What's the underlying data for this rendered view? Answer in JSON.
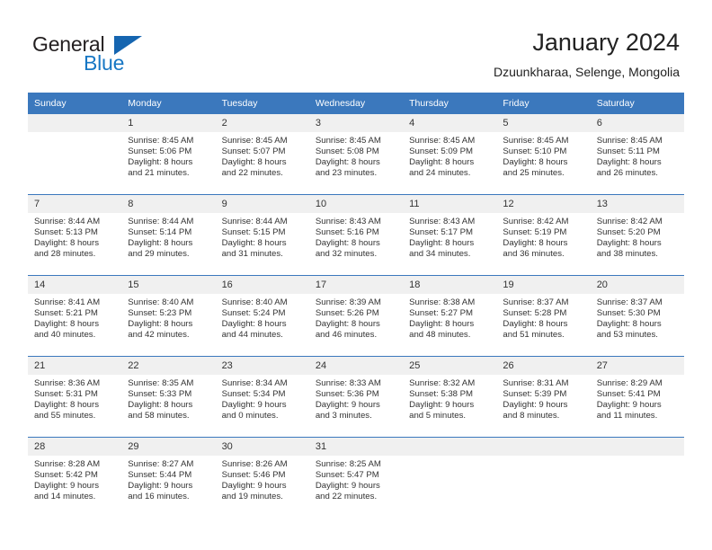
{
  "brand": {
    "name_top": "General",
    "name_bottom": "Blue",
    "triangle_color": "#1565b0",
    "blue_color": "#1777c4"
  },
  "header": {
    "title": "January 2024",
    "subtitle": "Dzuunkharaa, Selenge, Mongolia"
  },
  "theme": {
    "header_row_bg": "#3b78bd",
    "daynum_bg": "#f0f0f0",
    "grid_line": "#3b78bd"
  },
  "calendar": {
    "weekday_headers": [
      "Sunday",
      "Monday",
      "Tuesday",
      "Wednesday",
      "Thursday",
      "Friday",
      "Saturday"
    ],
    "weeks": [
      [
        {
          "day": "",
          "lines": []
        },
        {
          "day": "1",
          "lines": [
            "Sunrise: 8:45 AM",
            "Sunset: 5:06 PM",
            "Daylight: 8 hours",
            "and 21 minutes."
          ]
        },
        {
          "day": "2",
          "lines": [
            "Sunrise: 8:45 AM",
            "Sunset: 5:07 PM",
            "Daylight: 8 hours",
            "and 22 minutes."
          ]
        },
        {
          "day": "3",
          "lines": [
            "Sunrise: 8:45 AM",
            "Sunset: 5:08 PM",
            "Daylight: 8 hours",
            "and 23 minutes."
          ]
        },
        {
          "day": "4",
          "lines": [
            "Sunrise: 8:45 AM",
            "Sunset: 5:09 PM",
            "Daylight: 8 hours",
            "and 24 minutes."
          ]
        },
        {
          "day": "5",
          "lines": [
            "Sunrise: 8:45 AM",
            "Sunset: 5:10 PM",
            "Daylight: 8 hours",
            "and 25 minutes."
          ]
        },
        {
          "day": "6",
          "lines": [
            "Sunrise: 8:45 AM",
            "Sunset: 5:11 PM",
            "Daylight: 8 hours",
            "and 26 minutes."
          ]
        }
      ],
      [
        {
          "day": "7",
          "lines": [
            "Sunrise: 8:44 AM",
            "Sunset: 5:13 PM",
            "Daylight: 8 hours",
            "and 28 minutes."
          ]
        },
        {
          "day": "8",
          "lines": [
            "Sunrise: 8:44 AM",
            "Sunset: 5:14 PM",
            "Daylight: 8 hours",
            "and 29 minutes."
          ]
        },
        {
          "day": "9",
          "lines": [
            "Sunrise: 8:44 AM",
            "Sunset: 5:15 PM",
            "Daylight: 8 hours",
            "and 31 minutes."
          ]
        },
        {
          "day": "10",
          "lines": [
            "Sunrise: 8:43 AM",
            "Sunset: 5:16 PM",
            "Daylight: 8 hours",
            "and 32 minutes."
          ]
        },
        {
          "day": "11",
          "lines": [
            "Sunrise: 8:43 AM",
            "Sunset: 5:17 PM",
            "Daylight: 8 hours",
            "and 34 minutes."
          ]
        },
        {
          "day": "12",
          "lines": [
            "Sunrise: 8:42 AM",
            "Sunset: 5:19 PM",
            "Daylight: 8 hours",
            "and 36 minutes."
          ]
        },
        {
          "day": "13",
          "lines": [
            "Sunrise: 8:42 AM",
            "Sunset: 5:20 PM",
            "Daylight: 8 hours",
            "and 38 minutes."
          ]
        }
      ],
      [
        {
          "day": "14",
          "lines": [
            "Sunrise: 8:41 AM",
            "Sunset: 5:21 PM",
            "Daylight: 8 hours",
            "and 40 minutes."
          ]
        },
        {
          "day": "15",
          "lines": [
            "Sunrise: 8:40 AM",
            "Sunset: 5:23 PM",
            "Daylight: 8 hours",
            "and 42 minutes."
          ]
        },
        {
          "day": "16",
          "lines": [
            "Sunrise: 8:40 AM",
            "Sunset: 5:24 PM",
            "Daylight: 8 hours",
            "and 44 minutes."
          ]
        },
        {
          "day": "17",
          "lines": [
            "Sunrise: 8:39 AM",
            "Sunset: 5:26 PM",
            "Daylight: 8 hours",
            "and 46 minutes."
          ]
        },
        {
          "day": "18",
          "lines": [
            "Sunrise: 8:38 AM",
            "Sunset: 5:27 PM",
            "Daylight: 8 hours",
            "and 48 minutes."
          ]
        },
        {
          "day": "19",
          "lines": [
            "Sunrise: 8:37 AM",
            "Sunset: 5:28 PM",
            "Daylight: 8 hours",
            "and 51 minutes."
          ]
        },
        {
          "day": "20",
          "lines": [
            "Sunrise: 8:37 AM",
            "Sunset: 5:30 PM",
            "Daylight: 8 hours",
            "and 53 minutes."
          ]
        }
      ],
      [
        {
          "day": "21",
          "lines": [
            "Sunrise: 8:36 AM",
            "Sunset: 5:31 PM",
            "Daylight: 8 hours",
            "and 55 minutes."
          ]
        },
        {
          "day": "22",
          "lines": [
            "Sunrise: 8:35 AM",
            "Sunset: 5:33 PM",
            "Daylight: 8 hours",
            "and 58 minutes."
          ]
        },
        {
          "day": "23",
          "lines": [
            "Sunrise: 8:34 AM",
            "Sunset: 5:34 PM",
            "Daylight: 9 hours",
            "and 0 minutes."
          ]
        },
        {
          "day": "24",
          "lines": [
            "Sunrise: 8:33 AM",
            "Sunset: 5:36 PM",
            "Daylight: 9 hours",
            "and 3 minutes."
          ]
        },
        {
          "day": "25",
          "lines": [
            "Sunrise: 8:32 AM",
            "Sunset: 5:38 PM",
            "Daylight: 9 hours",
            "and 5 minutes."
          ]
        },
        {
          "day": "26",
          "lines": [
            "Sunrise: 8:31 AM",
            "Sunset: 5:39 PM",
            "Daylight: 9 hours",
            "and 8 minutes."
          ]
        },
        {
          "day": "27",
          "lines": [
            "Sunrise: 8:29 AM",
            "Sunset: 5:41 PM",
            "Daylight: 9 hours",
            "and 11 minutes."
          ]
        }
      ],
      [
        {
          "day": "28",
          "lines": [
            "Sunrise: 8:28 AM",
            "Sunset: 5:42 PM",
            "Daylight: 9 hours",
            "and 14 minutes."
          ]
        },
        {
          "day": "29",
          "lines": [
            "Sunrise: 8:27 AM",
            "Sunset: 5:44 PM",
            "Daylight: 9 hours",
            "and 16 minutes."
          ]
        },
        {
          "day": "30",
          "lines": [
            "Sunrise: 8:26 AM",
            "Sunset: 5:46 PM",
            "Daylight: 9 hours",
            "and 19 minutes."
          ]
        },
        {
          "day": "31",
          "lines": [
            "Sunrise: 8:25 AM",
            "Sunset: 5:47 PM",
            "Daylight: 9 hours",
            "and 22 minutes."
          ]
        },
        {
          "day": "",
          "lines": []
        },
        {
          "day": "",
          "lines": []
        },
        {
          "day": "",
          "lines": []
        }
      ]
    ]
  }
}
